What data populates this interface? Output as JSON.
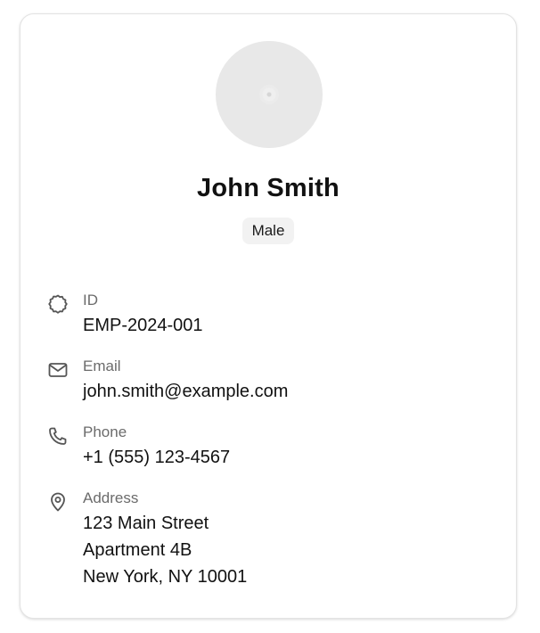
{
  "profile": {
    "name": "John Smith",
    "gender": "Male",
    "avatar_icon": "user-placeholder-icon"
  },
  "fields": {
    "id": {
      "label": "ID",
      "value": "EMP-2024-001",
      "icon": "badge-icon"
    },
    "email": {
      "label": "Email",
      "value": "john.smith@example.com",
      "icon": "mail-icon"
    },
    "phone": {
      "label": "Phone",
      "value": "+1 (555) 123-4567",
      "icon": "phone-icon"
    },
    "address": {
      "label": "Address",
      "lines": [
        "123 Main Street",
        "Apartment 4B",
        "New York, NY 10001"
      ],
      "icon": "map-pin-icon"
    }
  },
  "colors": {
    "label": "#6b6b6b",
    "text": "#111111",
    "badge_bg": "#f2f2f2",
    "avatar_bg": "#e8e8e8",
    "border": "#e3e3e3"
  }
}
